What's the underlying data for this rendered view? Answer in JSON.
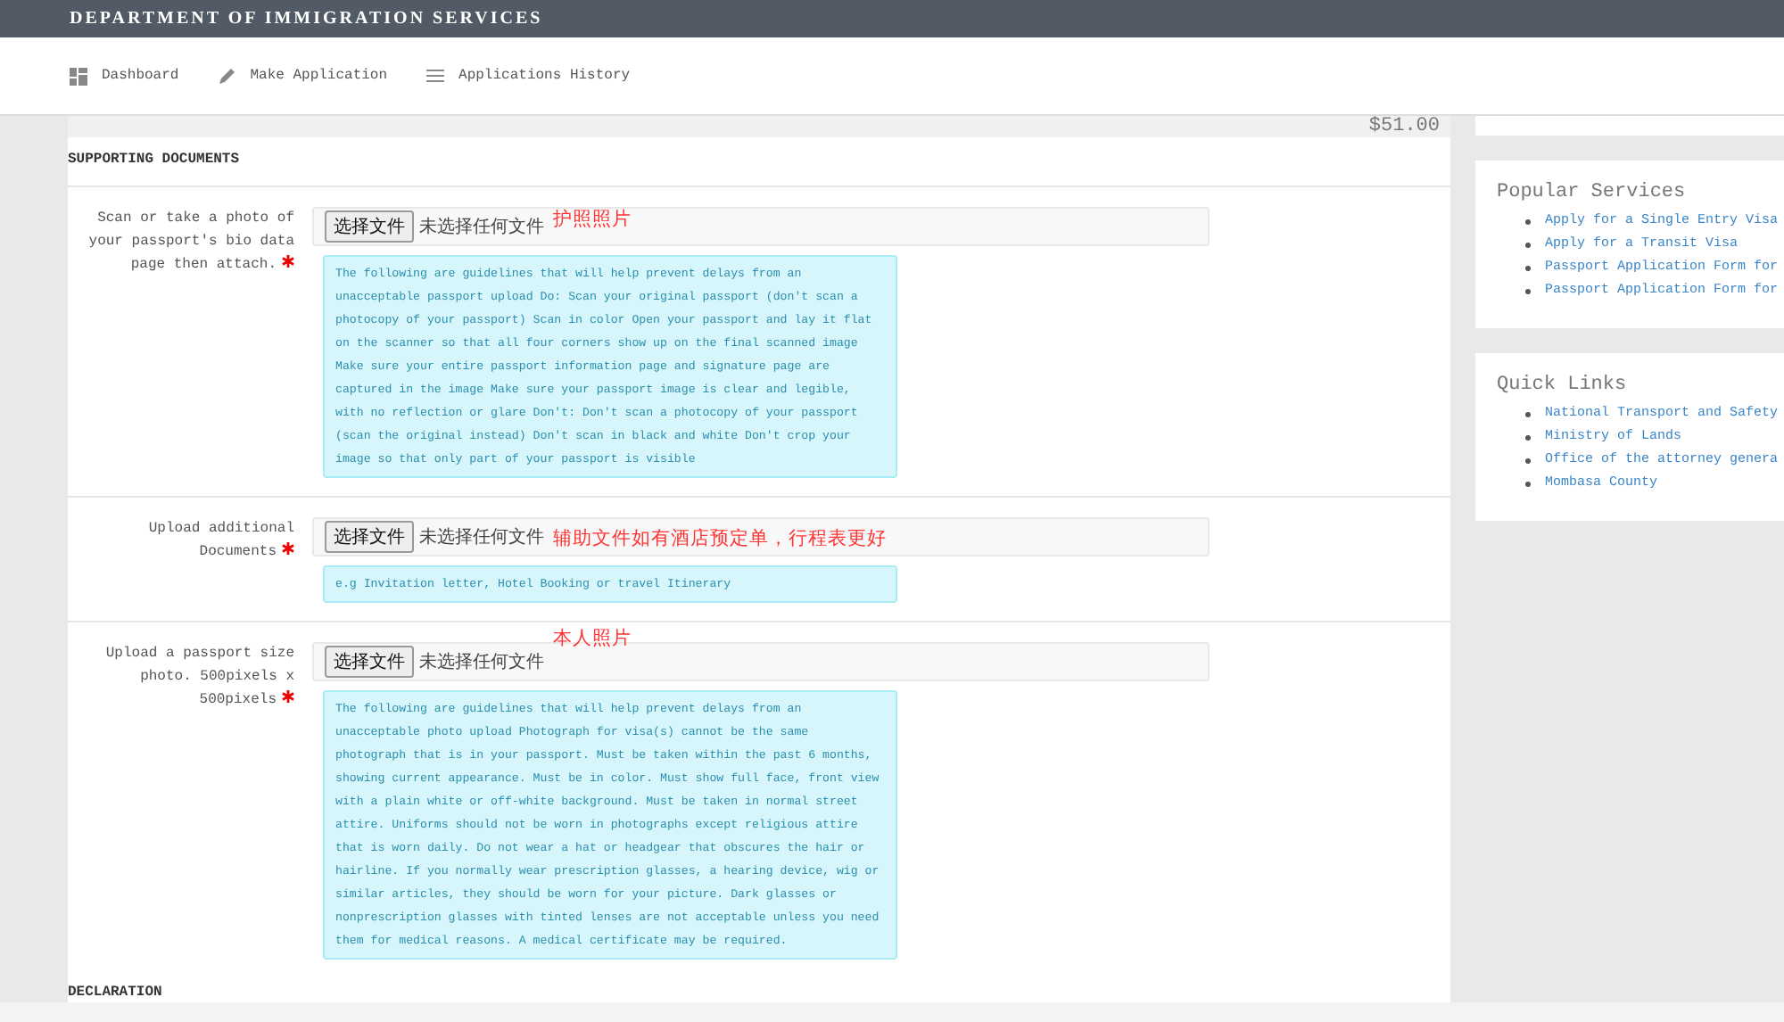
{
  "header": {
    "title": "DEPARTMENT OF IMMIGRATION SERVICES"
  },
  "nav": [
    {
      "kind": "grid",
      "label": "Dashboard"
    },
    {
      "kind": "pencil",
      "label": "Make Application"
    },
    {
      "kind": "list",
      "label": "Applications History"
    }
  ],
  "amount": "$51.00",
  "section_title": "SUPPORTING DOCUMENTS",
  "uploads": [
    {
      "label": "Scan or take a photo of your passport's bio data page then attach.",
      "required": true,
      "button": "选择文件",
      "file_status": "未选择任何文件",
      "annotation": "护照照片",
      "help": "The following are guidelines that will help prevent delays from an unacceptable passport upload Do: Scan your original passport (don't scan a photocopy of your passport) Scan in color Open your passport and lay it flat on the scanner so that all four corners show up on the final scanned image Make sure your entire passport information page and signature page are captured in the image Make sure your passport image is clear and legible, with no reflection or glare Don't: Don't scan a photocopy of your passport (scan the original instead) Don't scan in black and white Don't crop your image so that only part of your passport is visible"
    },
    {
      "label": "Upload additional Documents",
      "required": true,
      "button": "选择文件",
      "file_status": "未选择任何文件",
      "annotation": "辅助文件如有酒店预定单，行程表更好",
      "help": "e.g Invitation letter, Hotel Booking or travel Itinerary"
    },
    {
      "label": "Upload a passport size photo. 500pixels x 500pixels",
      "required": true,
      "button": "选择文件",
      "file_status": "未选择任何文件",
      "annotation": "本人照片",
      "help": "The following are guidelines that will help prevent delays from an unacceptable photo upload Photograph for visa(s) cannot be the same photograph that is in your passport. Must be taken within the past 6 months, showing current appearance. Must be in color. Must show full face, front view with a plain white or off-white background. Must be taken in normal street attire. Uniforms should not be worn in photographs except religious attire that is worn daily. Do not wear a hat or headgear that obscures the hair or hairline. If you normally wear prescription glasses, a hearing device, wig or similar articles, they should be worn for your picture. Dark glasses or nonprescription glasses with tinted lenses are not acceptable unless you need them for medical reasons. A medical certificate may be required."
    }
  ],
  "next_section_title": "DECLARATION",
  "sidebar": [
    {
      "title": "Popular Services",
      "links": [
        "Apply for a Single Entry Visa",
        "Apply for a Transit Visa",
        "Passport Application Form for",
        "Passport Application Form for"
      ]
    },
    {
      "title": "Quick Links",
      "links": [
        "National Transport and Safety",
        "Ministry of Lands",
        "Office of the attorney genera",
        "Mombasa County"
      ]
    }
  ]
}
